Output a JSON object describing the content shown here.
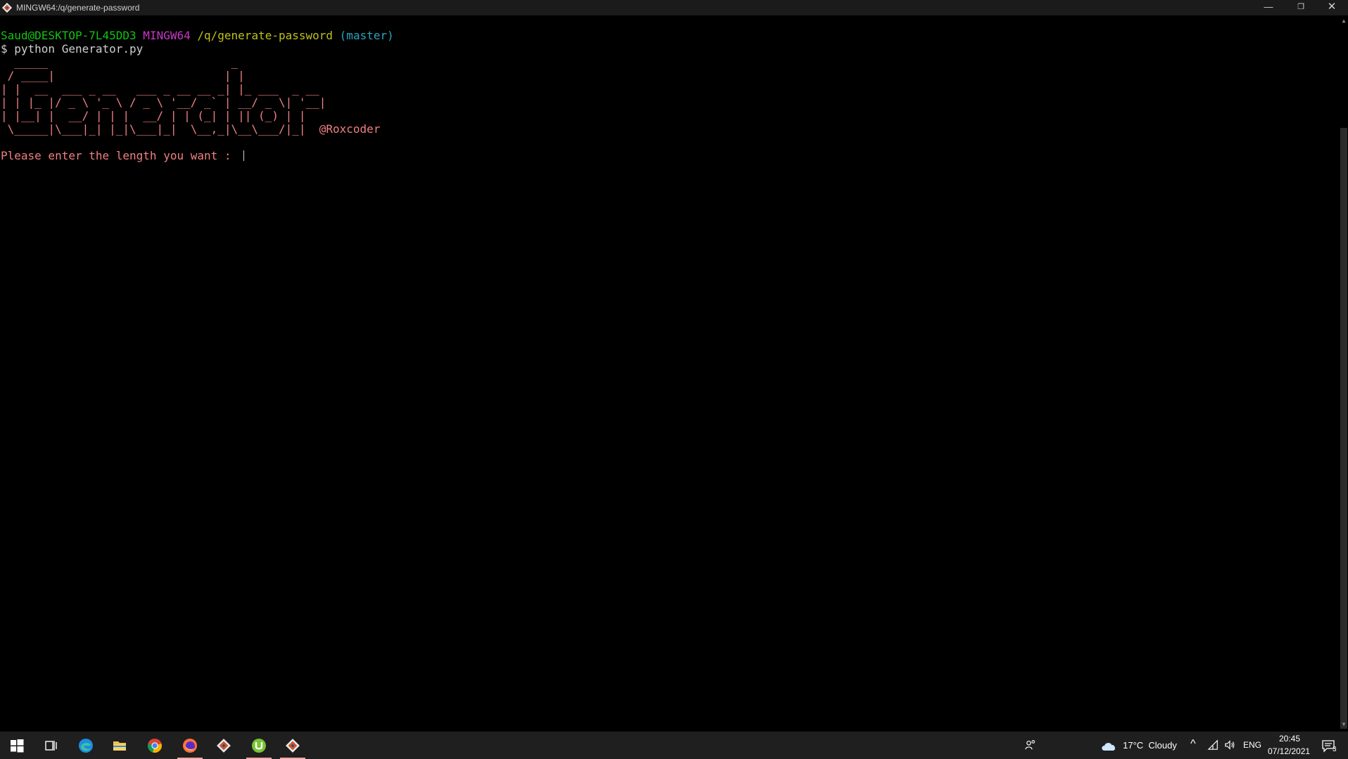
{
  "window": {
    "title": "MINGW64:/q/generate-password",
    "controls": {
      "minimize": "—",
      "maximize": "❐",
      "close": "✕"
    }
  },
  "terminal": {
    "prompt": {
      "user_host": "Saud@DESKTOP-7L45DD3",
      "env": "MINGW64",
      "path": "/q/generate-password",
      "branch": "(master)"
    },
    "command": "$ python Generator.py",
    "ascii_art": [
      "  _____                           _",
      " / ____|                         | |",
      "| |  __  ___ _ __   ___ _ __ __ _| |_ ___  _ __",
      "| | |_ |/ _ \\ '_ \\ / _ \\ '__/ _` | __/ _ \\| '__|",
      "| |__| |  __/ | | |  __/ | | (_| | || (_) | |",
      " \\_____|\\___|_| |_|\\___|_|  \\__,_|\\__\\___/|_|"
    ],
    "ascii_handle": "@Roxcoder",
    "input_prompt": "Please enter the length you want : "
  },
  "taskbar": {
    "apps": [
      {
        "name": "start-button",
        "icon": "windows-logo-icon",
        "active": false
      },
      {
        "name": "task-view-button",
        "icon": "task-view-icon",
        "active": false
      },
      {
        "name": "edge-button",
        "icon": "edge-icon",
        "active": false
      },
      {
        "name": "file-explorer-button",
        "icon": "folder-icon",
        "active": false
      },
      {
        "name": "chrome-button",
        "icon": "chrome-icon",
        "active": false
      },
      {
        "name": "firefox-button",
        "icon": "firefox-icon",
        "active": true
      },
      {
        "name": "git-gui-button",
        "icon": "git-icon",
        "active": false
      },
      {
        "name": "utorrent-button",
        "icon": "utorrent-icon",
        "active": true
      },
      {
        "name": "git-bash-button",
        "icon": "git-bash-icon",
        "active": true
      }
    ],
    "tray": {
      "weather": "17°C  Cloudy",
      "language": "ENG",
      "time": "20:45",
      "date": "07/12/2021",
      "notifications": "3"
    }
  }
}
